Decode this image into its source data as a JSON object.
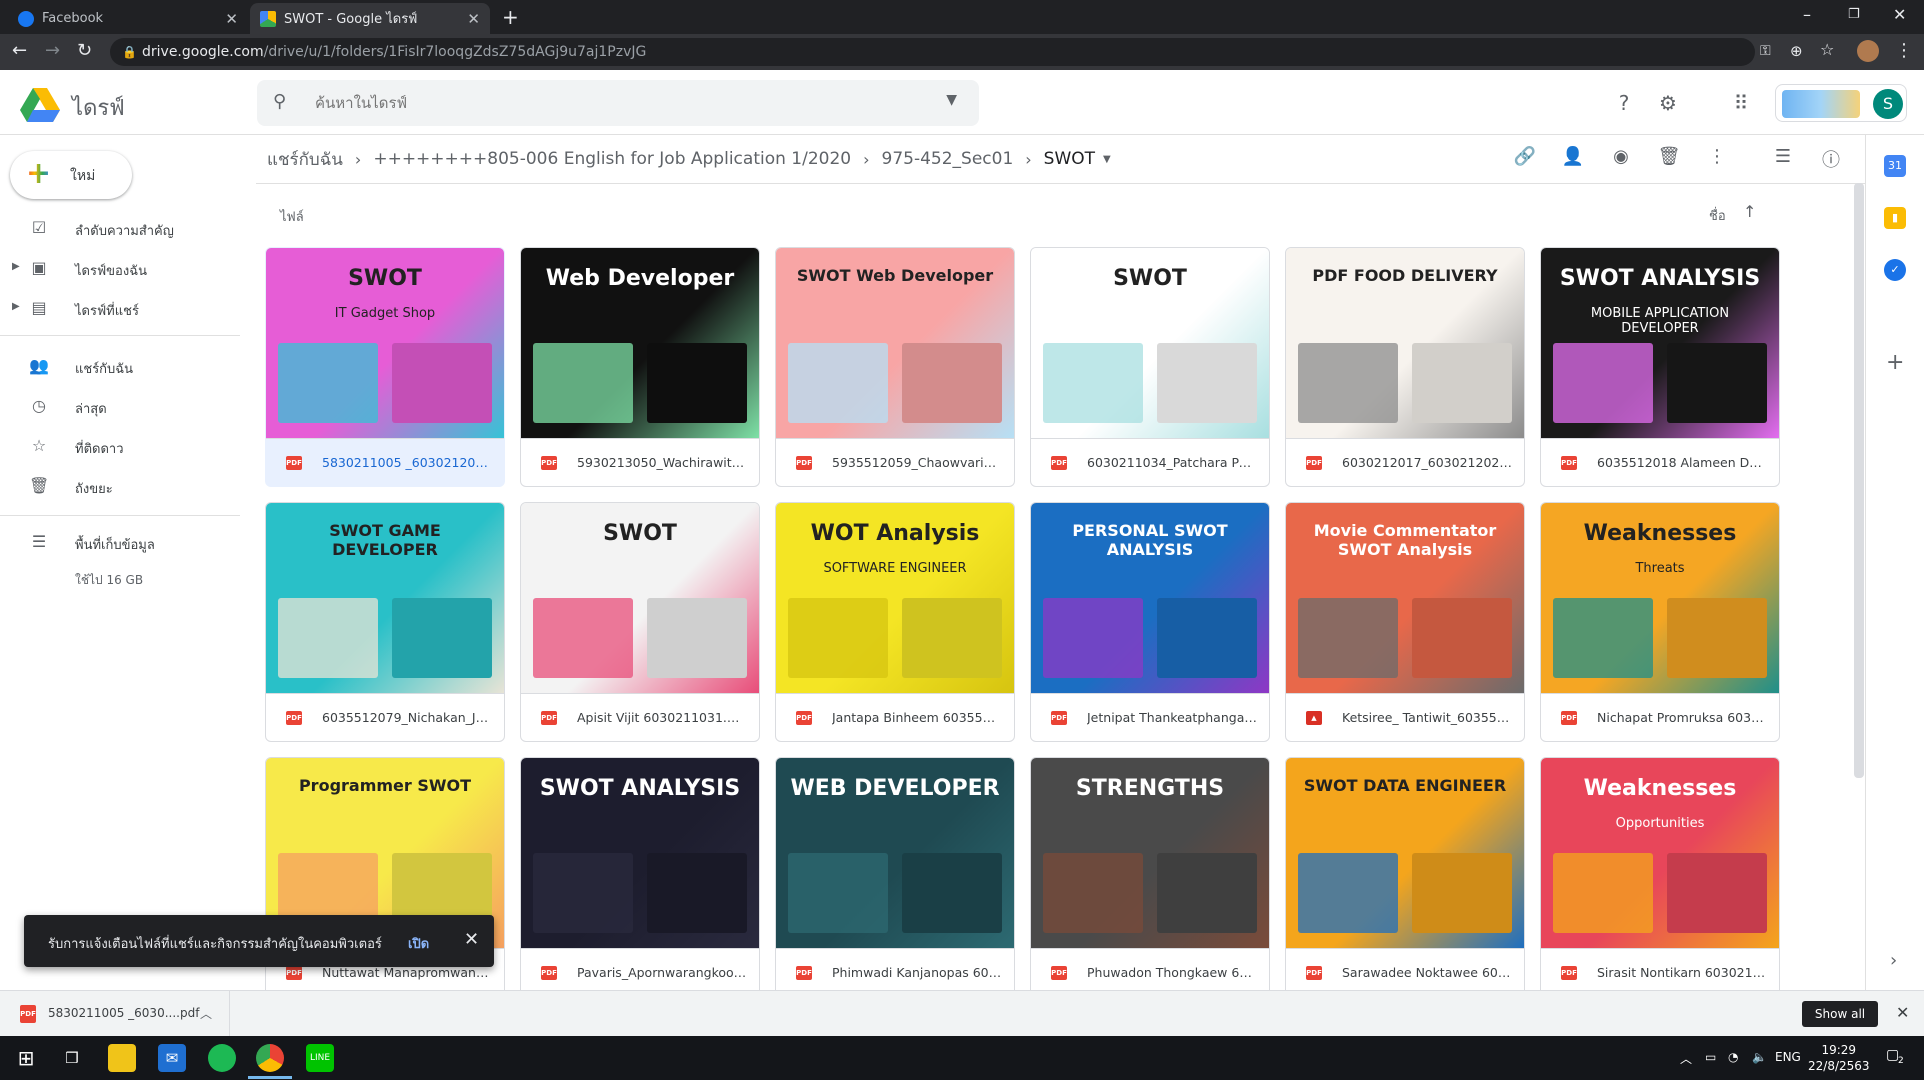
{
  "browser": {
    "tabs": [
      {
        "title": "Facebook",
        "active": false
      },
      {
        "title": "SWOT - Google ไดรฟ์",
        "active": true
      }
    ],
    "url_host": "drive.google.com",
    "url_path": "/drive/u/1/folders/1FisIr7looqgZdsZ75dAGj9u7aj1PzvJG"
  },
  "drive": {
    "app_title": "ไดรฟ์",
    "search_placeholder": "ค้นหาในไดรฟ์",
    "account_initial": "S",
    "new_button": "ใหม่",
    "nav": [
      {
        "label": "ลำดับความสำคัญ",
        "icon": "priority-icon"
      },
      {
        "label": "ไดรฟ์ของฉัน",
        "icon": "my-drive-icon"
      },
      {
        "label": "ไดรฟ์ที่แชร์",
        "icon": "shared-drives-icon"
      },
      {
        "label": "แชร์กับฉัน",
        "icon": "shared-with-me-icon"
      },
      {
        "label": "ล่าสุด",
        "icon": "recent-icon"
      },
      {
        "label": "ที่ติดดาว",
        "icon": "starred-icon"
      },
      {
        "label": "ถังขยะ",
        "icon": "trash-icon"
      }
    ],
    "storage": {
      "label": "พื้นที่เก็บข้อมูล",
      "used": "ใช้ไป 16 GB"
    },
    "breadcrumb": [
      "แชร์กับฉัน",
      "++++++++805-006 English for Job Application 1/2020",
      "975-452_Sec01",
      "SWOT"
    ],
    "section_label": "ไฟล์",
    "sort_label": "ชื่อ",
    "files": [
      {
        "name": "5830211005 _6030212050....",
        "type": "pdf",
        "selected": true,
        "title": "SWOT",
        "subtitle": "IT Gadget Shop",
        "colors": [
          "#e65dd6",
          "#36c3d6"
        ]
      },
      {
        "name": "5930213050_Wachirawit.pdf",
        "type": "pdf",
        "title": "Web Developer",
        "colors": [
          "#111111",
          "#7ee0a6"
        ]
      },
      {
        "name": "5935512059_Chaowvarin.p...",
        "type": "pdf",
        "title": "SWOT Web Developer",
        "colors": [
          "#f8a5a5",
          "#b6e0f5"
        ]
      },
      {
        "name": "6030211034_Patchara Pet...",
        "type": "pdf",
        "title": "SWOT",
        "colors": [
          "#ffffff",
          "#a8dfe0"
        ]
      },
      {
        "name": "6030212017_6030212027_...",
        "type": "pdf",
        "title": "PDF FOOD DELIVERY",
        "colors": [
          "#f7f3ee",
          "#8c8c8c"
        ]
      },
      {
        "name": "6035512018 Alameen Da-o...",
        "type": "pdf",
        "title": "SWOT ANALYSIS",
        "subtitle": "MOBILE APPLICATION DEVELOPER",
        "colors": [
          "#1a1a1a",
          "#e36ef0"
        ]
      },
      {
        "name": "6035512079_Nichakan_Jai...",
        "type": "pdf",
        "title": "SWOT GAME DEVELOPER",
        "colors": [
          "#29c0c8",
          "#e8e4d6"
        ]
      },
      {
        "name": "Apisit Vijit 6030211031.pdf",
        "type": "pdf",
        "title": "SWOT",
        "colors": [
          "#f3f3f3",
          "#e84d79"
        ]
      },
      {
        "name": "Jantapa Binheem 6035512...",
        "type": "pdf",
        "title": "WOT Analysis",
        "subtitle": "SOFTWARE ENGINEER",
        "colors": [
          "#f4e524",
          "#d6c410"
        ]
      },
      {
        "name": "Jetnipat Thankeatphangan ...",
        "type": "pdf",
        "title": "PERSONAL SWOT ANALYSIS",
        "colors": [
          "#1b6ec2",
          "#8e38c5"
        ]
      },
      {
        "name": "Ketsiree_ Tantiwit_6035512...",
        "type": "image",
        "title": "Movie Commentator SWOT Analysis",
        "colors": [
          "#e8684a",
          "#6b6b6b"
        ]
      },
      {
        "name": "Nichapat Promruksa 60302...",
        "type": "pdf",
        "title": "Weaknesses",
        "subtitle": "Threats",
        "colors": [
          "#f5a623",
          "#1f8f8a"
        ]
      },
      {
        "name": "Nuttawat Manapromwan-5...",
        "type": "pdf",
        "title": "Programmer SWOT",
        "colors": [
          "#f7e94a",
          "#f5a060"
        ]
      },
      {
        "name": "Pavaris_Apornwarangkool_...",
        "type": "pdf",
        "title": "SWOT ANALYSIS",
        "colors": [
          "#1d1d2e",
          "#2a2a3e"
        ]
      },
      {
        "name": "Phimwadi Kanjanopas 603...",
        "type": "pdf",
        "title": "WEB DEVELOPER",
        "colors": [
          "#1f4a52",
          "#2d6a72"
        ]
      },
      {
        "name": "Phuwadon Thongkaew 603...",
        "type": "pdf",
        "title": "STRENGTHS",
        "colors": [
          "#4a4a4a",
          "#7a4b3a"
        ]
      },
      {
        "name": "Sarawadee Noktawee 6035...",
        "type": "pdf",
        "title": "SWOT DATA ENGINEER",
        "colors": [
          "#f4a51c",
          "#1f6fbf"
        ]
      },
      {
        "name": "Sirasit Nontikarn 60302110...",
        "type": "pdf",
        "title": "Weaknesses",
        "subtitle": "Opportunities",
        "colors": [
          "#e8465a",
          "#f4a51c"
        ]
      }
    ],
    "toast": {
      "message": "รับการแจ้งเตือนไฟล์ที่แชร์และกิจกรรมสำคัญในคอมพิวเตอร์",
      "action": "เปิด"
    }
  },
  "downloads": {
    "file": "5830211005 _6030....pdf",
    "show_all": "Show all"
  },
  "taskbar": {
    "lang": "ENG",
    "time": "19:29",
    "date": "22/8/2563",
    "notifications": "2"
  }
}
